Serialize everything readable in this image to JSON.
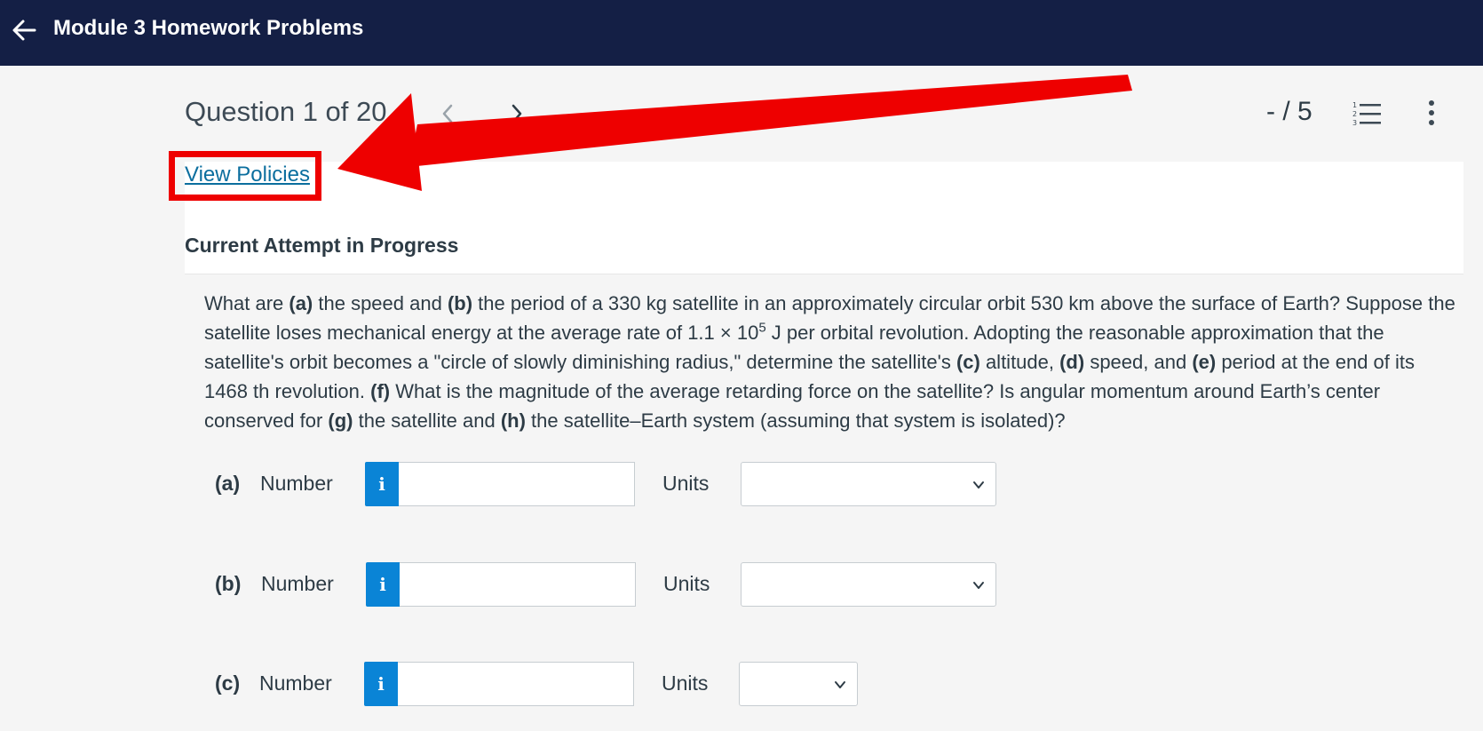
{
  "header": {
    "title": "Module 3 Homework Problems"
  },
  "question_nav": {
    "counter": "Question 1 of 20",
    "score": "- / 5"
  },
  "policies": {
    "link_label": "View Policies"
  },
  "attempt": {
    "heading": "Current Attempt in Progress"
  },
  "question": {
    "segments": [
      {
        "t": "What are ",
        "b": false
      },
      {
        "t": "(a)",
        "b": true
      },
      {
        "t": " the speed and ",
        "b": false
      },
      {
        "t": "(b)",
        "b": true
      },
      {
        "t": " the period of a 330 kg satellite in an approximately circular orbit 530 km above the surface of Earth? Suppose the satellite loses mechanical energy at the average rate of 1.1 × 10",
        "b": false
      },
      {
        "t": "5",
        "b": false,
        "sup": true
      },
      {
        "t": " J per orbital revolution. Adopting the reasonable approximation that the satellite's orbit becomes a \"circle of slowly diminishing radius,\" determine the satellite's ",
        "b": false
      },
      {
        "t": "(c)",
        "b": true
      },
      {
        "t": " altitude, ",
        "b": false
      },
      {
        "t": "(d)",
        "b": true
      },
      {
        "t": " speed, and ",
        "b": false
      },
      {
        "t": "(e)",
        "b": true
      },
      {
        "t": " period at the end of its 1468 th revolution. ",
        "b": false
      },
      {
        "t": "(f)",
        "b": true
      },
      {
        "t": " What is the magnitude of the average retarding force on the satellite? Is angular momentum around Earth’s center conserved for ",
        "b": false
      },
      {
        "t": "(g)",
        "b": true
      },
      {
        "t": " the satellite and ",
        "b": false
      },
      {
        "t": "(h)",
        "b": true
      },
      {
        "t": " the satellite–Earth system (assuming that system is isolated)?",
        "b": false
      }
    ]
  },
  "answers": [
    {
      "part": "(a)",
      "number_label": "Number",
      "info": "i",
      "value": "",
      "units_label": "Units",
      "units_value": ""
    },
    {
      "part": "(b)",
      "number_label": "Number",
      "info": "i",
      "value": "",
      "units_label": "Units",
      "units_value": ""
    },
    {
      "part": "(c)",
      "number_label": "Number",
      "info": "i",
      "value": "",
      "units_label": "Units",
      "units_value": ""
    }
  ],
  "colors": {
    "topbar": "#141f45",
    "info_button": "#0a84d6",
    "link": "#0b6e9e",
    "annotation": "#ee0000"
  },
  "icons": {
    "back": "arrow-left-icon",
    "prev": "chevron-left-icon",
    "next": "chevron-right-icon",
    "list": "numbered-list-icon",
    "more": "vertical-ellipsis-icon",
    "info": "info-icon"
  }
}
